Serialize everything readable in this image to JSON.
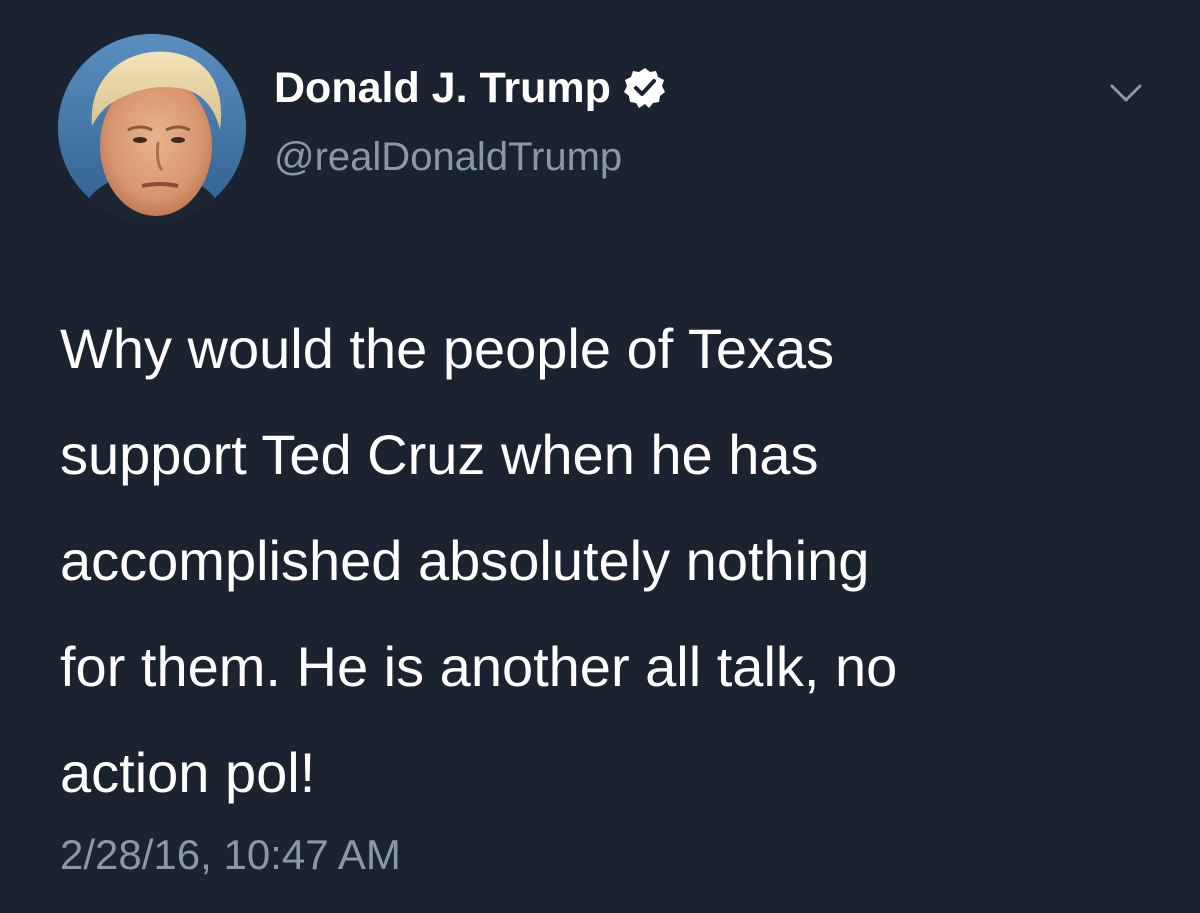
{
  "tweet": {
    "author": {
      "display_name": "Donald J. Trump",
      "handle": "@realDonaldTrump",
      "verified": true,
      "avatar_icon": "profile-photo"
    },
    "text": "Why would the people of Texas\nsupport Ted Cruz when he has\naccomplished absolutely nothing\nfor them. He is another all talk, no\naction pol!",
    "timestamp": "2/28/16, 10:47 AM",
    "menu_icon": "chevron-down-icon"
  },
  "colors": {
    "background": "#1b2330",
    "primary_text": "#ffffff",
    "secondary_text": "#8899a6",
    "verified_badge": "#ffffff"
  }
}
